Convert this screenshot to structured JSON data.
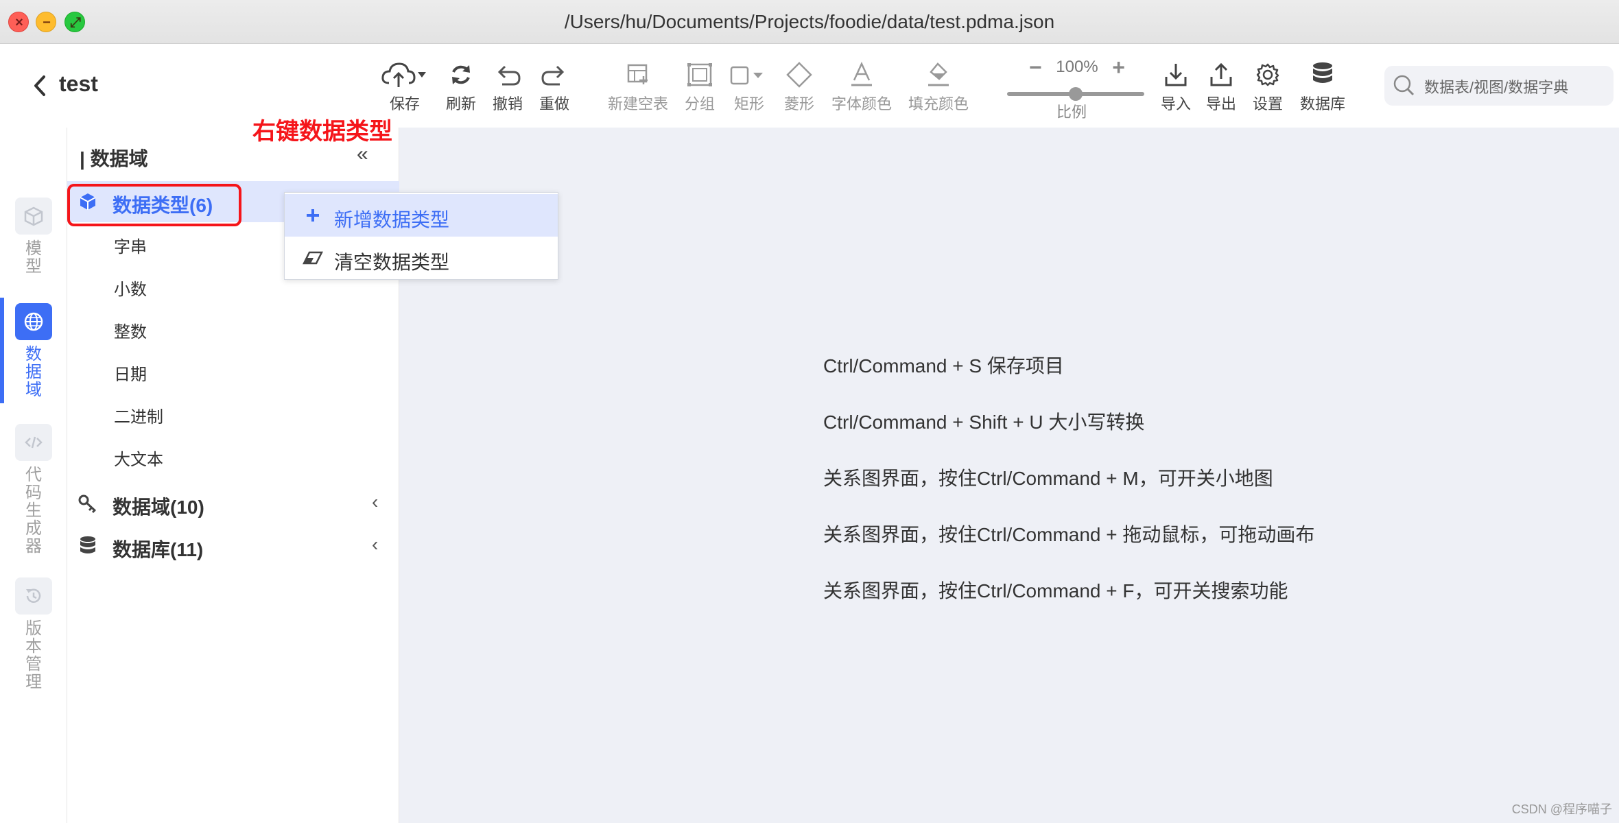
{
  "window": {
    "title": "/Users/hu/Documents/Projects/foodie/data/test.pdma.json",
    "close_glyph": "×",
    "min_glyph": "−",
    "max_glyph": "⤢"
  },
  "header": {
    "project_name": "test",
    "back_icon": "chevron-left-icon"
  },
  "toolbar": {
    "save": "保存",
    "refresh": "刷新",
    "undo": "撤销",
    "redo": "重做",
    "new_table": "新建空表",
    "group": "分组",
    "rect": "矩形",
    "diamond": "菱形",
    "font_color": "字体颜色",
    "fill_color": "填充颜色",
    "zoom_value": "100%",
    "zoom_minus": "−",
    "zoom_plus": "+",
    "zoom_label": "比例",
    "zoom_level": 0.5,
    "import": "导入",
    "export": "导出",
    "settings": "设置",
    "database": "数据库"
  },
  "search": {
    "placeholder": "数据表/视图/数据字典"
  },
  "rail": {
    "model": "模型",
    "domain": "数据域",
    "codegen": "代码生成器",
    "version": "版本管理",
    "accent": "#3d6ef5"
  },
  "panel": {
    "title": "| 数据域",
    "collapse_glyph": "«",
    "groups": [
      {
        "label": "数据类型(6)",
        "icon": "cube-icon"
      },
      {
        "label": "数据域(10)",
        "icon": "key-icon"
      },
      {
        "label": "数据库(11)",
        "icon": "database-icon"
      }
    ],
    "types": [
      "字串",
      "小数",
      "整数",
      "日期",
      "二进制",
      "大文本"
    ],
    "arrow_glyph": "‹"
  },
  "annotation": {
    "text": "右键数据类型",
    "color": "#f5151a"
  },
  "context_menu": {
    "items": [
      {
        "label": "新增数据类型",
        "icon": "plus-icon"
      },
      {
        "label": "清空数据类型",
        "icon": "eraser-icon"
      }
    ]
  },
  "hints": [
    "Ctrl/Command + S 保存项目",
    "Ctrl/Command + Shift + U 大小写转换",
    "关系图界面，按住Ctrl/Command + M，可开关小地图",
    "关系图界面，按住Ctrl/Command + 拖动鼠标，可拖动画布",
    "关系图界面，按住Ctrl/Command + F，可开关搜索功能"
  ],
  "watermark": "CSDN @程序喵子"
}
